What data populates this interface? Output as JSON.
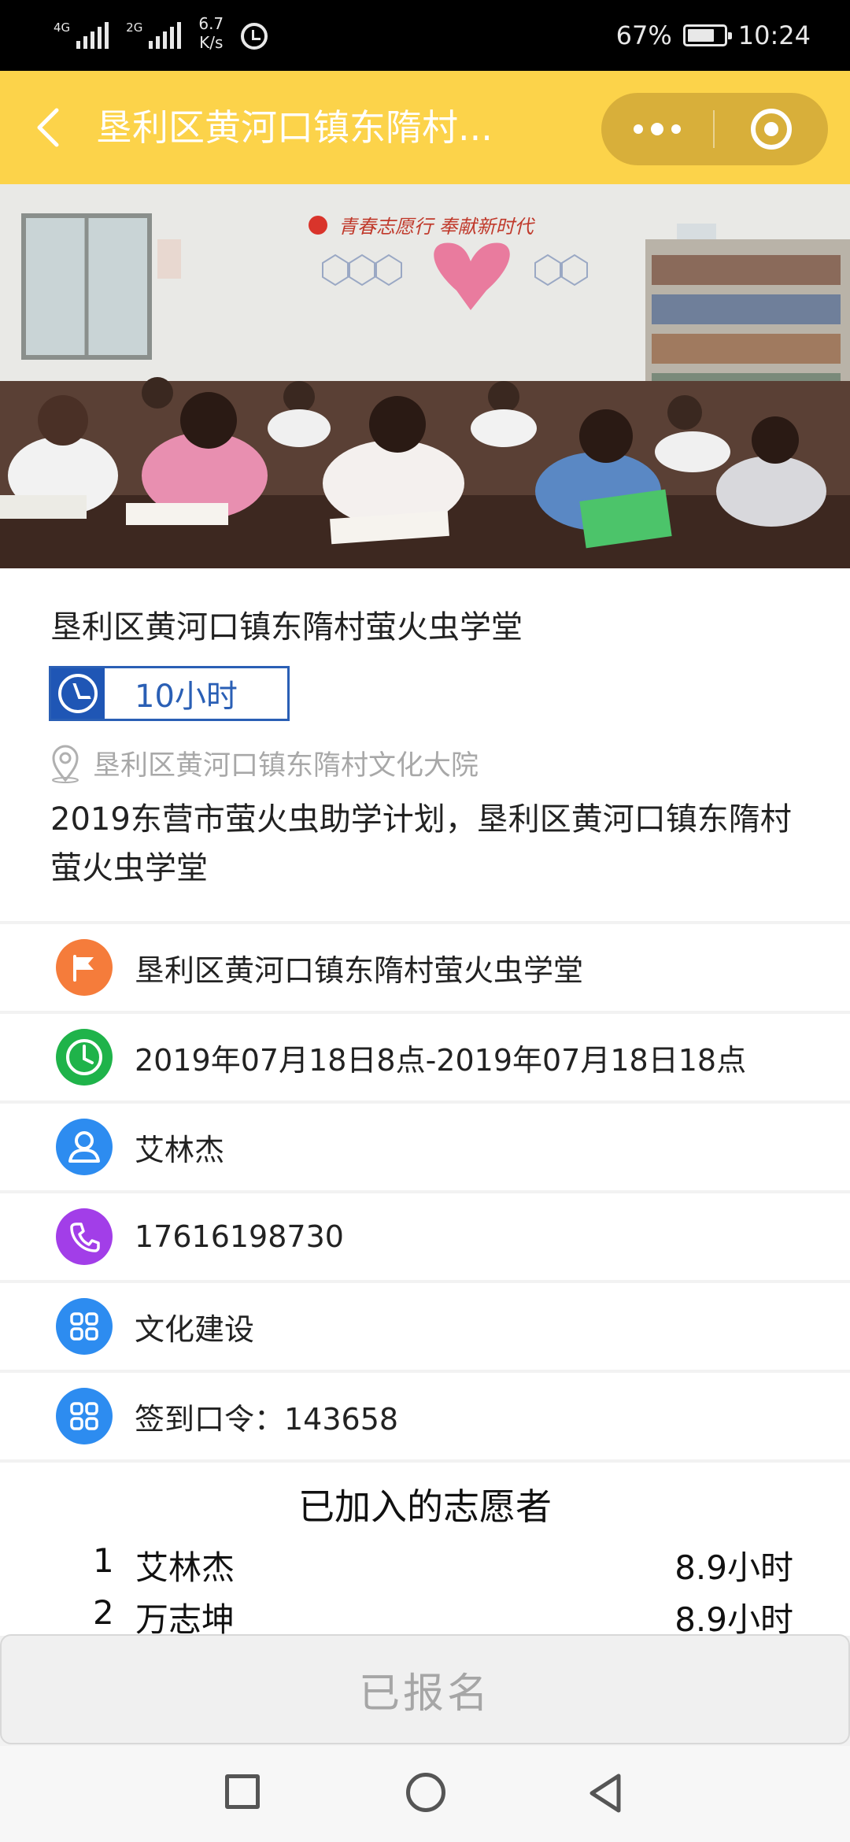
{
  "status_bar": {
    "signal1_label": "4G",
    "signal2_label": "2G",
    "net_speed_value": "6.7",
    "net_speed_unit": "K/s",
    "battery": "67%",
    "battery_level": 0.67,
    "time": "10:24"
  },
  "header": {
    "title": "垦利区黄河口镇东隋村..."
  },
  "activity": {
    "title": "垦利区黄河口镇东隋村萤火虫学堂",
    "duration": "10小时",
    "address": "垦利区黄河口镇东隋村文化大院",
    "description": "2019东营市萤火虫助学计划，垦利区黄河口镇东隋村萤火虫学堂"
  },
  "details": [
    {
      "icon": "flag-icon",
      "color": "#f57c3b",
      "text": "垦利区黄河口镇东隋村萤火虫学堂"
    },
    {
      "icon": "clock-icon",
      "color": "#1fb34a",
      "text": "2019年07月18日8点-2019年07月18日18点"
    },
    {
      "icon": "person-icon",
      "color": "#2d8cf0",
      "text": "艾林杰"
    },
    {
      "icon": "phone-icon",
      "color": "#a23ee8",
      "text": "17616198730"
    },
    {
      "icon": "grid-icon",
      "color": "#2d8cf0",
      "text": "文化建设"
    },
    {
      "icon": "grid-icon",
      "color": "#2d8cf0",
      "text": "签到口令：143658"
    }
  ],
  "volunteers": {
    "title": "已加入的志愿者",
    "list": [
      {
        "no": "1",
        "name": "艾林杰",
        "hours": "8.9小时"
      },
      {
        "no": "2",
        "name": "万志坤",
        "hours": "8.9小时"
      }
    ]
  },
  "signup_button": "已报名",
  "photo_banner_text": "青春志愿行 奉献新时代"
}
